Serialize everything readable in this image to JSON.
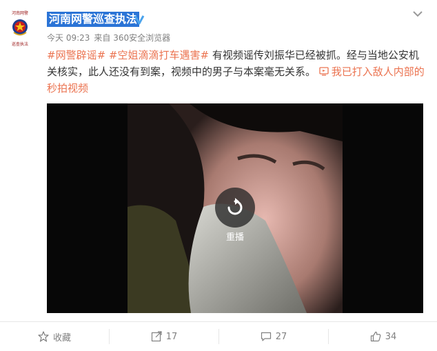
{
  "post": {
    "author": "河南网警巡查执法",
    "avatar_text": [
      "河南网警",
      "巡查执法"
    ],
    "time": "今天 09:23",
    "source": "来自 360安全浏览器",
    "topics": [
      "#网警辟谣#",
      "#空姐滴滴打车遇害#"
    ],
    "text": "有视频谣传刘振华已经被抓。经与当地公安机关核实，此人还没有到案，视频中的男子与本案毫无关系。",
    "video_link": "我已打入敌人内部的秒拍视频"
  },
  "video": {
    "replay_label": "重播"
  },
  "actions": {
    "favorite": "收藏",
    "repost_count": "17",
    "comment_count": "27",
    "like_count": "34"
  },
  "colors": {
    "topic": "#eb7350",
    "username_highlight": "#2b74d6",
    "verified": "#4aa3ec",
    "badge_red": "#c81e1e"
  }
}
